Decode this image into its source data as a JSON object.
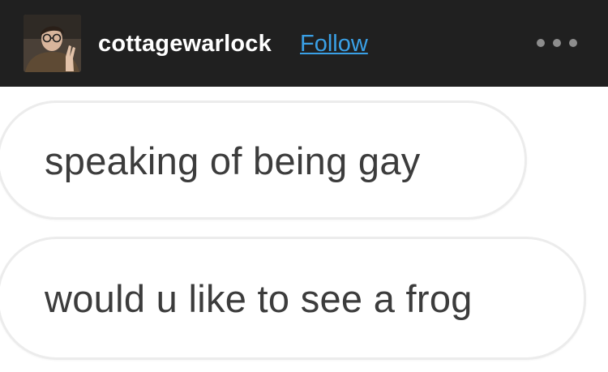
{
  "post": {
    "username": "cottagewarlock",
    "follow_label": "Follow",
    "avatar_icon": "user-avatar-photo",
    "more_icon": "more-horizontal-icon"
  },
  "messages": [
    {
      "text": "speaking of being gay"
    },
    {
      "text": "would u like to see a frog"
    }
  ],
  "colors": {
    "header_bg": "#202020",
    "follow_link": "#3aa0e6",
    "bubble_border": "#ececec",
    "message_text": "#3c3c3c"
  }
}
